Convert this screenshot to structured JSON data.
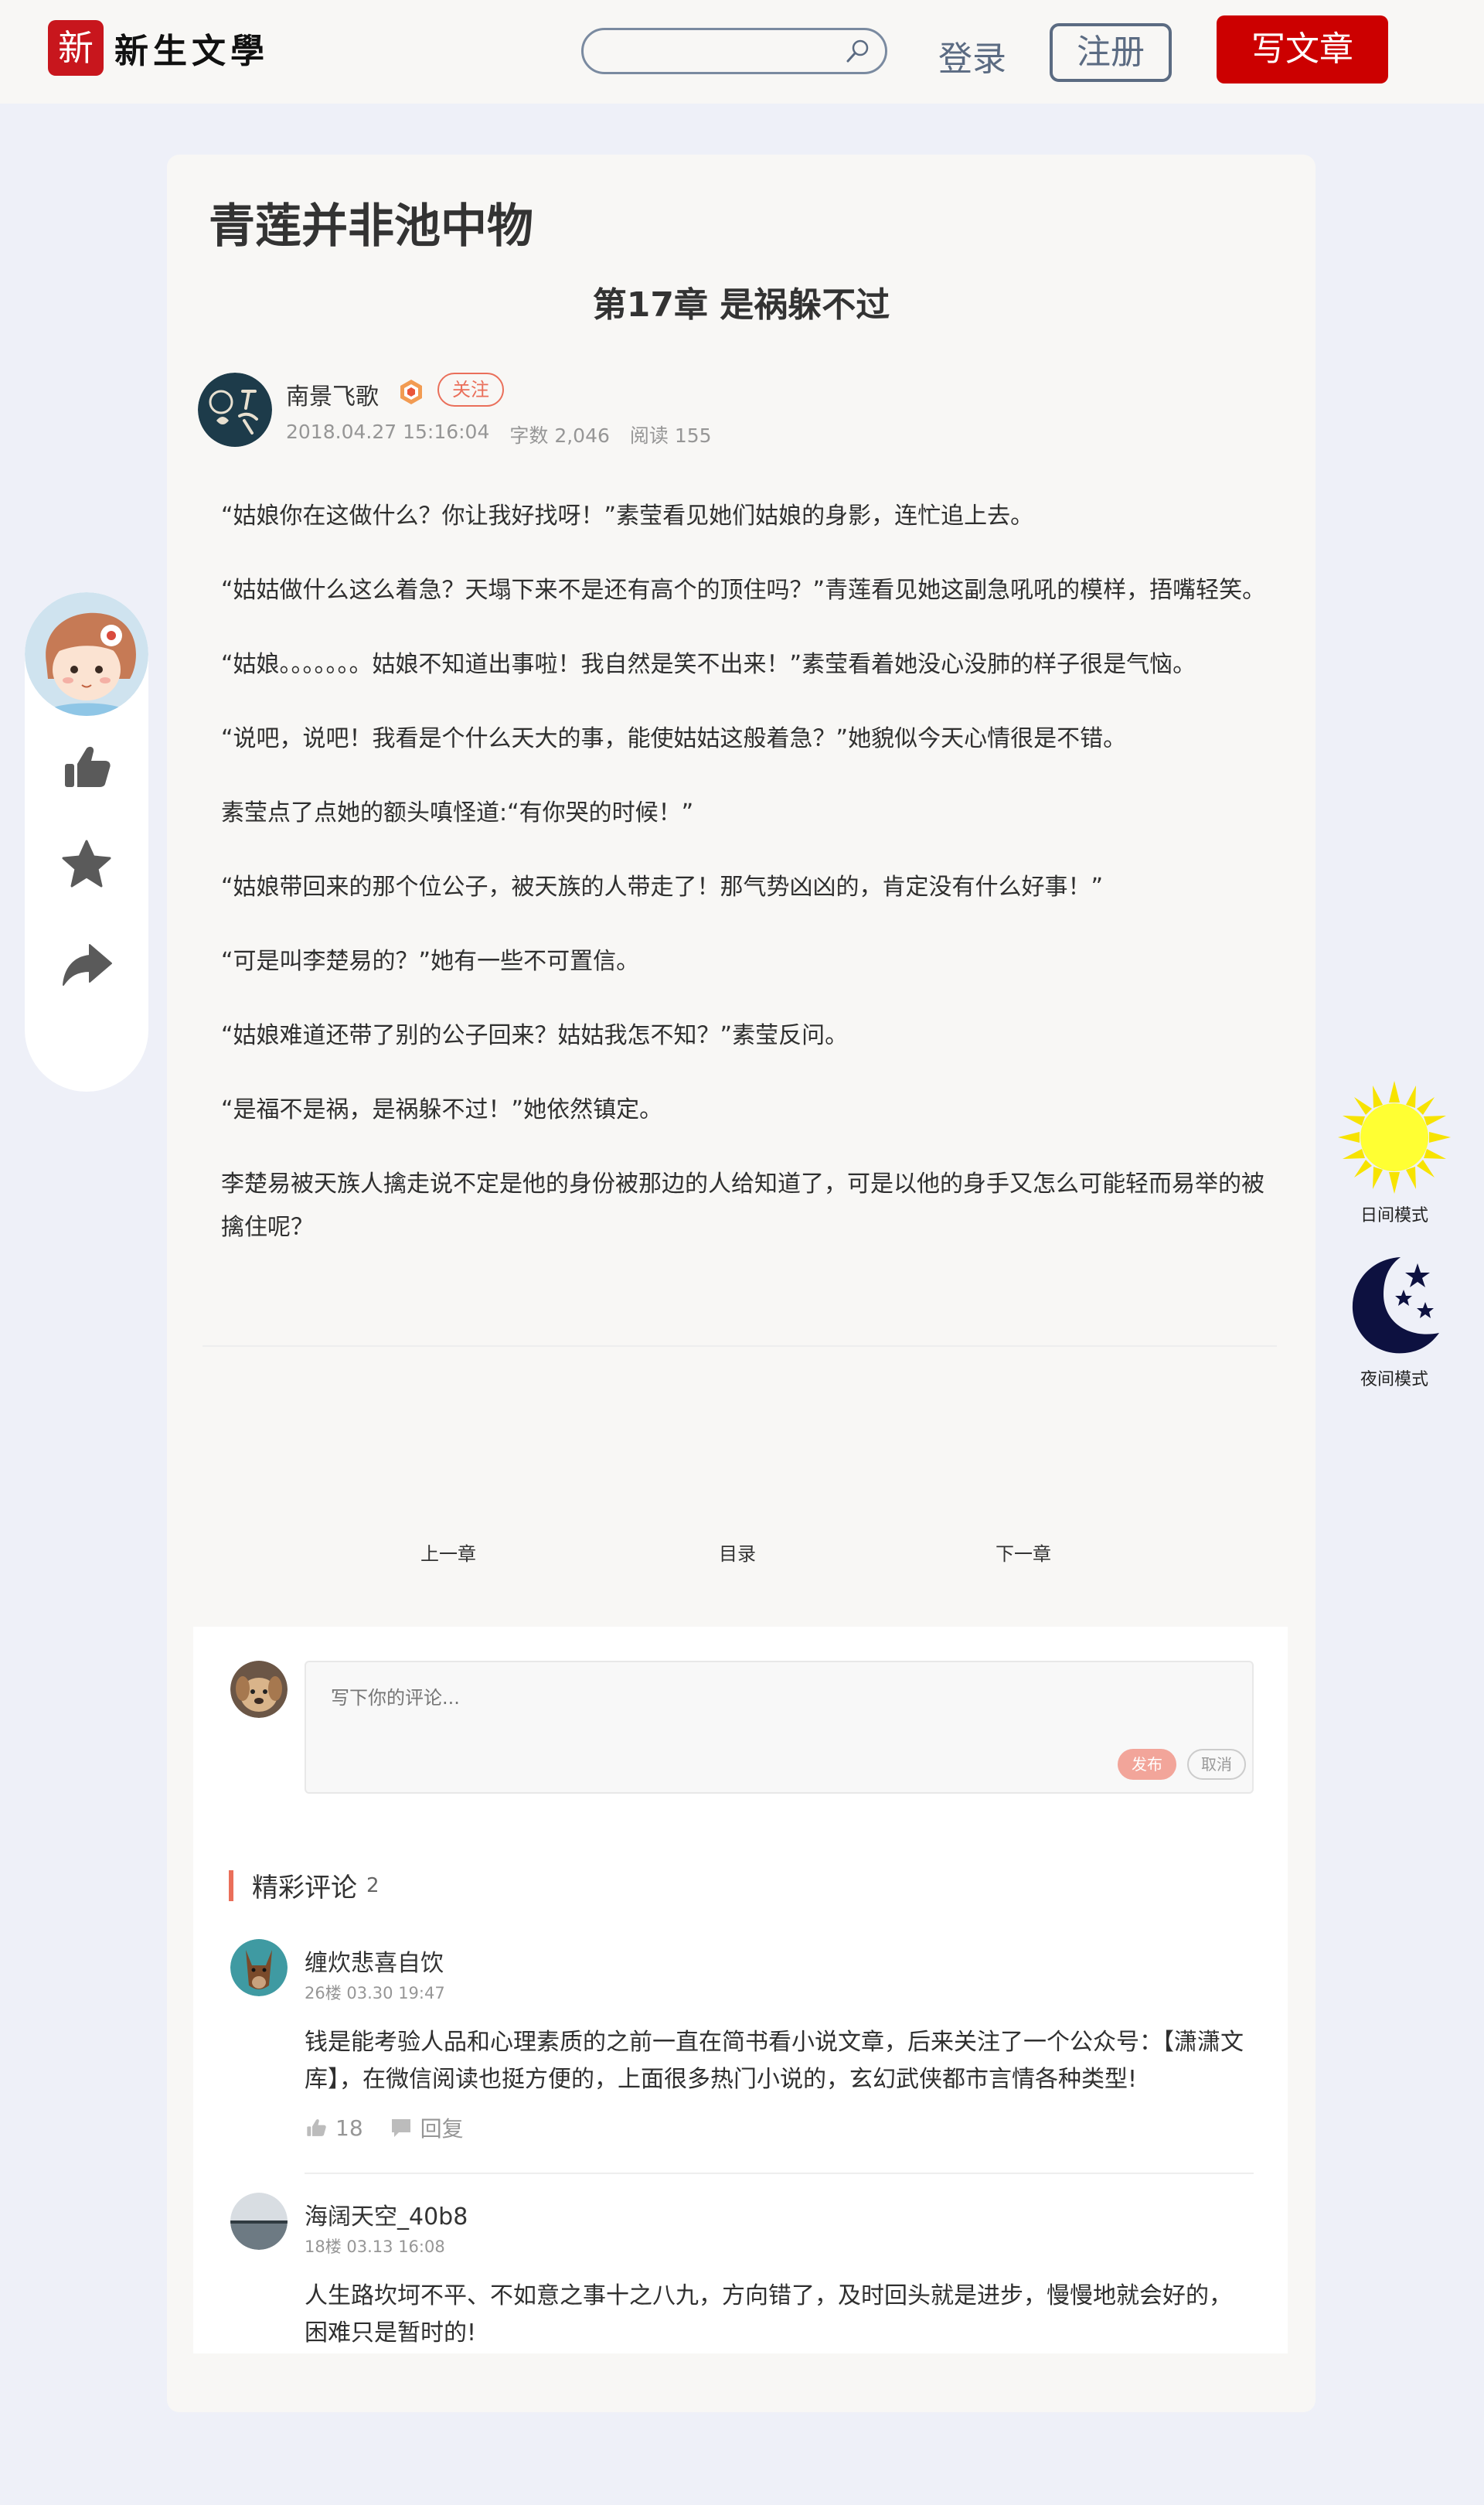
{
  "header": {
    "logo_mark": "新",
    "logo_text": "新生文學",
    "search_placeholder": "",
    "login_label": "登录",
    "register_label": "注册",
    "write_label": "写文章"
  },
  "article": {
    "novel_title": "青莲并非池中物",
    "chapter_title": "第17章 是祸躲不过",
    "author": {
      "name": "南景飞歌",
      "follow_label": "关注",
      "date": "2018.04.27 15:16:04",
      "word_count": "字数 2,046",
      "read_count": "阅读 155"
    },
    "paragraphs": [
      "“姑娘你在这做什么？你让我好找呀！”素莹看见她们姑娘的身影，连忙追上去。",
      "“姑姑做什么这么着急？天塌下来不是还有高个的顶住吗？”青莲看见她这副急吼吼的模样，捂嘴轻笑。",
      "“姑娘。。。。。。。姑娘不知道出事啦！我自然是笑不出来！”素莹看着她没心没肺的样子很是气恼。",
      "“说吧，说吧！我看是个什么天大的事，能使姑姑这般着急？”她貌似今天心情很是不错。",
      "素莹点了点她的额头嗔怪道:“有你哭的时候！”",
      "“姑娘带回来的那个位公子，被天族的人带走了！那气势凶凶的，肯定没有什么好事！”",
      "“可是叫李楚易的？”她有一些不可置信。",
      "“姑娘难道还带了别的公子回来？姑姑我怎不知？”素莹反问。",
      "“是福不是祸，是祸躲不过！”她依然镇定。",
      "李楚易被天族人擒走说不定是他的身份被那边的人给知道了，可是以他的身手又怎么可能轻而易举的被擒住呢？"
    ]
  },
  "chapter_nav": {
    "prev_label": "上一章",
    "toc_label": "目录",
    "next_label": "下一章"
  },
  "comment_form": {
    "placeholder": "写下你的评论...",
    "publish_label": "发布",
    "cancel_label": "取消"
  },
  "comments_section": {
    "title": "精彩评论",
    "count": "2",
    "items": [
      {
        "name": "缠炊悲喜自饮",
        "meta": "26楼 03.30 19:47",
        "text": "钱是能考验人品和心理素质的之前一直在简书看小说文章，后来关注了一个公众号：【潇潇文库】，在微信阅读也挺方便的，上面很多热门小说的，玄幻武侠都市言情各种类型!",
        "likes": "18",
        "reply_label": "回复"
      },
      {
        "name": "海阔天空_40b8",
        "meta": "18楼 03.13 16:08",
        "text": "人生路坎坷不平、不如意之事十之八九，方向错了，及时回头就是进步，慢慢地就会好的，困难只是暂时的!"
      }
    ]
  },
  "theme": {
    "day_label": "日间模式",
    "night_label": "夜间模式"
  },
  "colors": {
    "accent": "#ea6f5a",
    "brand_red": "#cc0000",
    "nav_slate": "#5b6b82",
    "page_bg": "#eef0f8"
  },
  "icons": {
    "search": "search-icon",
    "like": "thumbs-up-icon",
    "favorite": "star-icon",
    "share": "share-icon",
    "day": "sun-icon",
    "night": "moon-icon"
  }
}
